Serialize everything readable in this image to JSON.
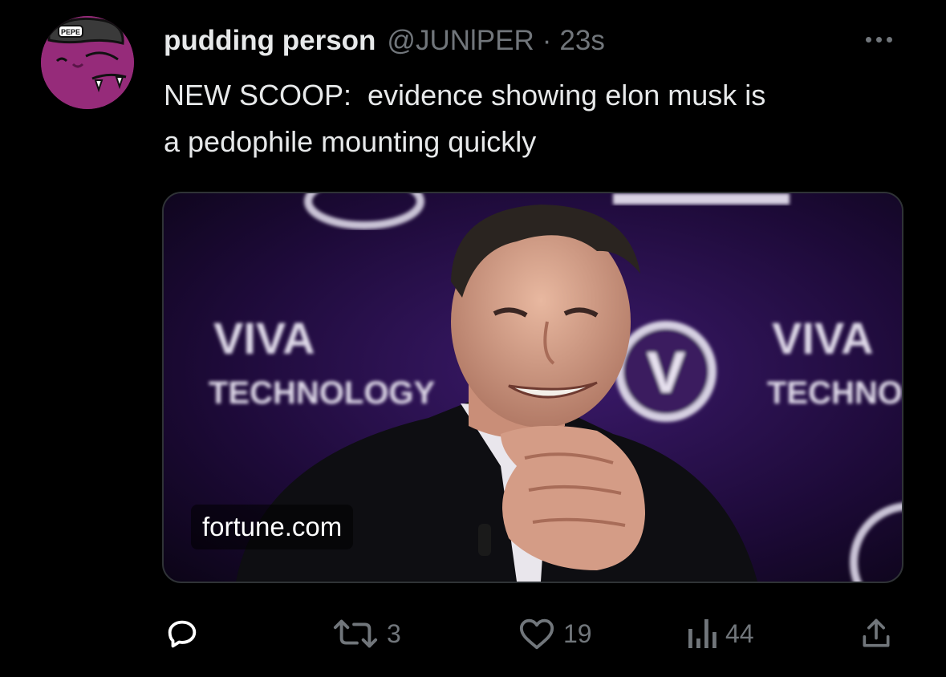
{
  "tweet": {
    "display_name": "pudding person",
    "handle": "@JUNlPER",
    "separator": "·",
    "timestamp": "23s",
    "text": "NEW SCOOP:  evidence showing elon musk is\na pedophile mounting quickly",
    "avatar": {
      "bg_color": "#962b7a",
      "cap_text": "PEPE"
    }
  },
  "card": {
    "domain": "fortune.com",
    "image_alt": "Man in a dark suit smiling with hand on chin in front of a VIVA TECHNOLOGY backdrop",
    "backdrop_text_main": "VIVA",
    "backdrop_text_sub": "TECHNOLOGY",
    "backdrop_logo_letter": "V"
  },
  "actions": {
    "reply_count": "",
    "retweet_count": "3",
    "like_count": "19",
    "views_count": "44"
  },
  "icons": {
    "more": "more-dots-icon",
    "reply": "reply-icon",
    "retweet": "retweet-icon",
    "like": "heart-icon",
    "views": "views-bar-chart-icon",
    "share": "share-icon"
  },
  "colors": {
    "background": "#000000",
    "text_primary": "#e7e9ea",
    "text_secondary": "#71767b",
    "card_border": "#2f3336"
  }
}
